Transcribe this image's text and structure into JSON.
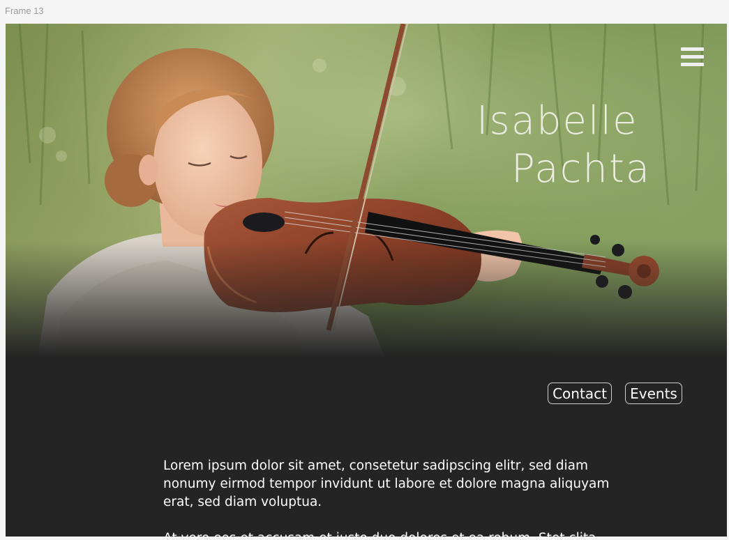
{
  "frame": {
    "label": "Frame 13"
  },
  "hero": {
    "image": "woman-playing-violin-in-meadow",
    "first_name": "Isabelle",
    "last_name": "Pachta",
    "menu_icon": "hamburger-menu-icon"
  },
  "nav": {
    "contact_label": "Contact",
    "events_label": "Events"
  },
  "content": {
    "paragraph_1": "Lorem ipsum dolor sit amet, consetetur sadipscing elitr, sed diam nonumy eirmod tempor invidunt ut labore et dolore magna aliquyam erat, sed diam voluptua.",
    "paragraph_2": "At vero eos et accusam et justo duo dolores et ea rebum. Stet clita"
  },
  "colors": {
    "page_bg": "#f5f5f5",
    "frame_bg": "#242424",
    "text": "#ffffff",
    "button_border": "#cfcfcf",
    "foliage": "#6f8a46"
  }
}
